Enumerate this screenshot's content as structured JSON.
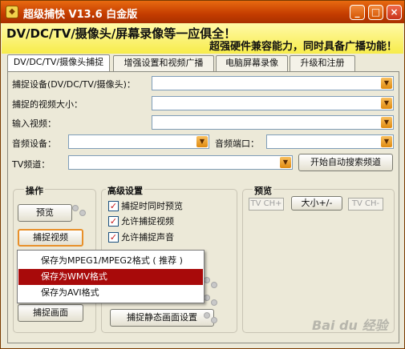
{
  "window": {
    "title": "超级捕快 V13.6 白金版",
    "min_label": "_",
    "max_label": "□",
    "close_label": "×"
  },
  "banner": {
    "line1": "DV/DC/TV/摄像头/屏幕录像等一应俱全！",
    "line2": "超强硬件兼容能力，同时具备广播功能！"
  },
  "tabs": [
    {
      "label": "DV/DC/TV/摄像头捕捉"
    },
    {
      "label": "增强设置和视频广播"
    },
    {
      "label": "电脑屏幕录像"
    },
    {
      "label": "升级和注册"
    }
  ],
  "form": {
    "capture_device_label": "捕捉设备(DV/DC/TV/摄像头)：",
    "video_size_label": "捕捉的视频大小：",
    "input_video_label": "输入视频：",
    "audio_device_label": "音频设备：",
    "audio_port_label": "音频端口：",
    "tv_channel_label": "TV频道：",
    "auto_search_label": "开始自动搜索频道"
  },
  "operation": {
    "title": "操作",
    "preview_label": "预览",
    "capture_video_label": "捕捉视频",
    "capture_frame_label": "捕捉画面"
  },
  "advanced": {
    "title": "高级设置",
    "options": [
      {
        "label": "捕捉时同时预览",
        "checked": true
      },
      {
        "label": "允许捕捉视频",
        "checked": true
      },
      {
        "label": "允许捕捉声音",
        "checked": true
      }
    ],
    "still_settings_label": "捕捉静态画面设置"
  },
  "preview": {
    "title": "预览",
    "tv_ch_plus": "TV CH+",
    "size_label": "大小+/-",
    "tv_ch_minus": "TV CH-"
  },
  "context_menu": {
    "items": [
      {
        "label": "保存为MPEG1/MPEG2格式 ( 推荐 )",
        "selected": false
      },
      {
        "label": "保存为WMV格式",
        "selected": true
      },
      {
        "label": "保存为AVI格式",
        "selected": false
      }
    ]
  },
  "watermark": "Bai du 经验",
  "colors": {
    "titlebar": "#c43c00",
    "banner": "#f7ec4a",
    "menu_highlight": "#a80a0a",
    "check_mark": "#c81a1a"
  }
}
